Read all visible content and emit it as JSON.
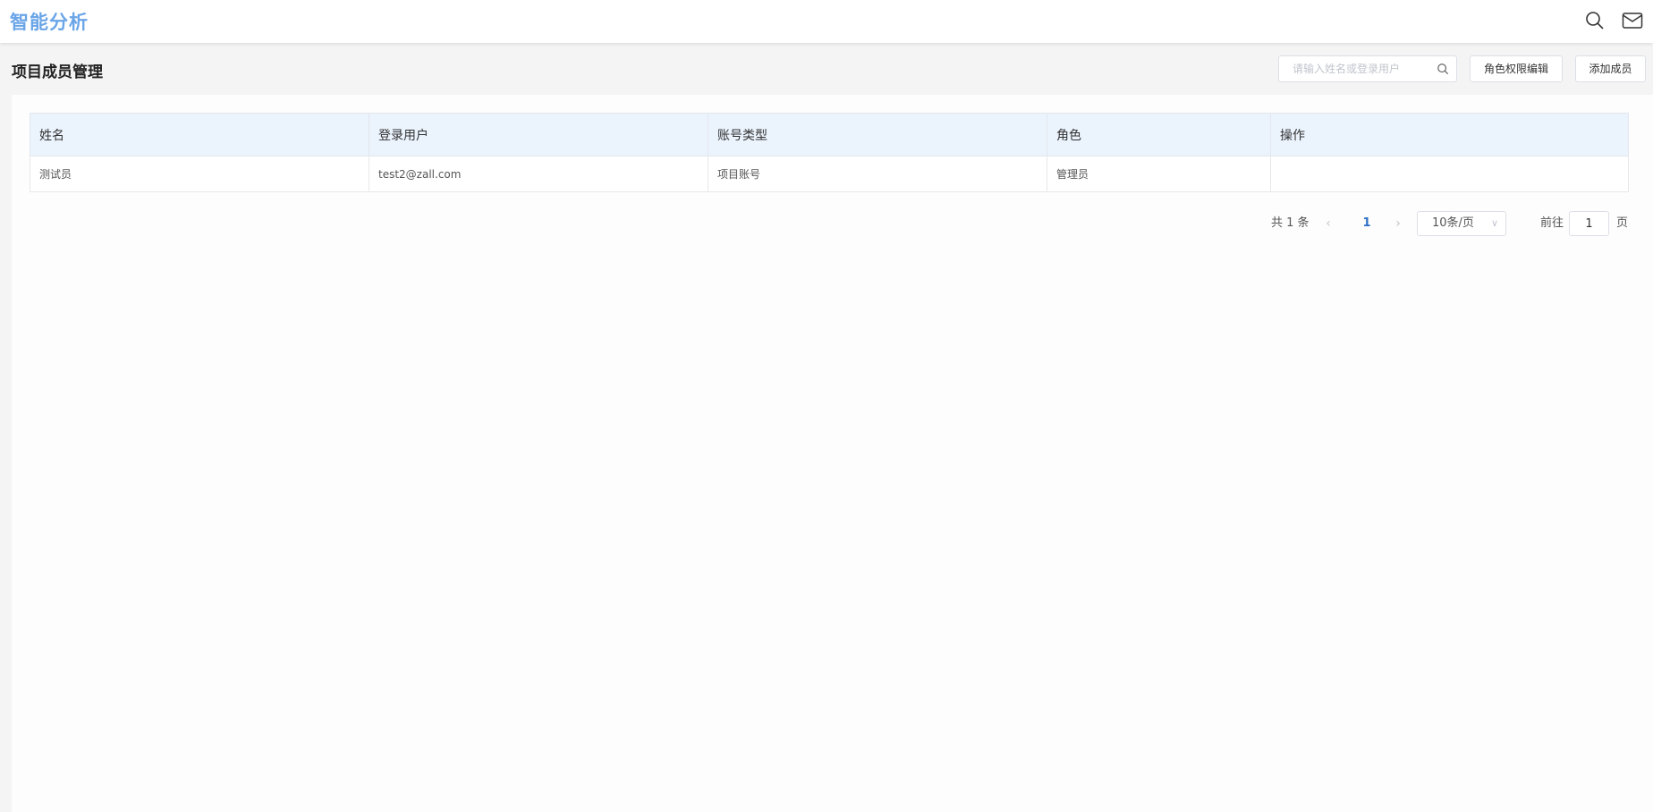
{
  "header": {
    "app_title": "智能分析",
    "icons": [
      "search-icon",
      "mail-icon"
    ]
  },
  "page": {
    "title": "项目成员管理",
    "search_placeholder": "请输入姓名或登录用户",
    "search_value": "",
    "role_edit_button": "角色权限编辑",
    "add_member_button": "添加成员"
  },
  "table": {
    "columns": [
      "姓名",
      "登录用户",
      "账号类型",
      "角色",
      "操作"
    ],
    "rows": [
      [
        "测试员",
        "test2@zall.com",
        "项目账号",
        "管理员",
        ""
      ]
    ]
  },
  "pagination": {
    "total_text": "共 1 条",
    "prev_icon": "chevron-left-icon",
    "current_page": "1",
    "next_icon": "chevron-right-icon",
    "page_size": "10条/页",
    "goto_label": "前往",
    "goto_value": "1",
    "page_suffix": "页"
  },
  "colors": {
    "brand": "#6aa5e8",
    "table_header_bg": "#ebf3fd",
    "active_page": "#2d6fc4"
  }
}
